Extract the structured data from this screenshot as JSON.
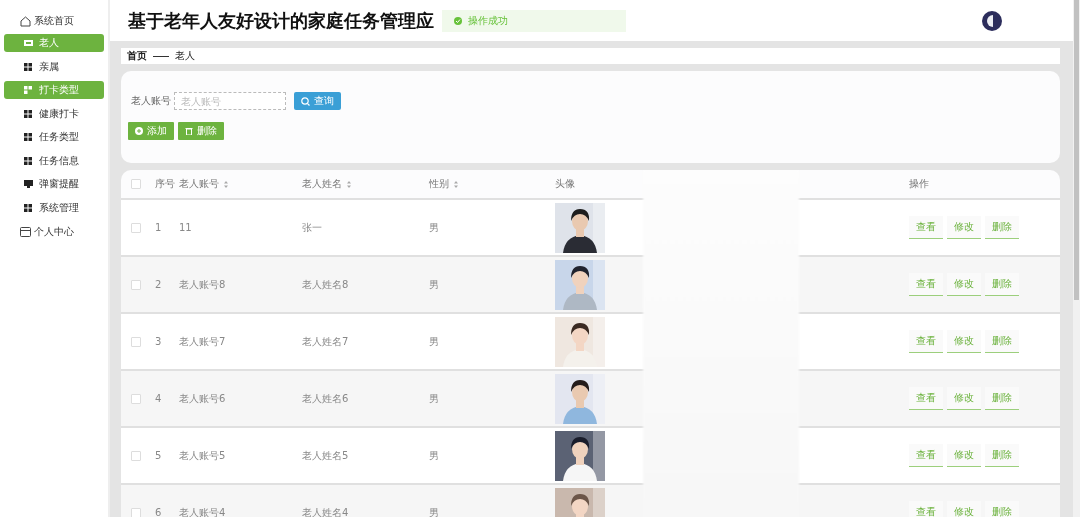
{
  "sidebar": {
    "home": "系统首页",
    "items": [
      {
        "label": "老人",
        "kind": "card",
        "selected": true
      },
      {
        "label": "亲属",
        "kind": "grid",
        "selected": false
      },
      {
        "label": "打卡类型",
        "kind": "grid",
        "selected": true
      },
      {
        "label": "健康打卡",
        "kind": "grid",
        "selected": false
      },
      {
        "label": "任务类型",
        "kind": "grid",
        "selected": false
      },
      {
        "label": "任务信息",
        "kind": "grid",
        "selected": false
      },
      {
        "label": "弹窗提醒",
        "kind": "monitor",
        "selected": false
      },
      {
        "label": "系统管理",
        "kind": "grid",
        "selected": false
      }
    ],
    "profile": "个人中心"
  },
  "header": {
    "title": "基于老年人友好设计的家庭任务管理应",
    "toast": "操作成功"
  },
  "breadcrumb": [
    "首页",
    "老人"
  ],
  "search": {
    "label": "老人账号",
    "placeholder": "老人账号",
    "button": "查询"
  },
  "actions": [
    "添加",
    "删除"
  ],
  "table": {
    "select_all_checked": false,
    "columns": [
      {
        "label": "序号",
        "sortable": false
      },
      {
        "label": "老人账号",
        "sortable": true
      },
      {
        "label": "老人姓名",
        "sortable": true
      },
      {
        "label": "性别",
        "sortable": true
      },
      {
        "label": "头像",
        "sortable": false
      },
      {
        "label": "操作",
        "sortable": false
      }
    ],
    "rows": [
      {
        "index": "1",
        "account": "11",
        "name": "张一",
        "gender": "男",
        "checked": false,
        "ops": [
          "查看",
          "修改",
          "删除"
        ]
      },
      {
        "index": "2",
        "account": "老人账号8",
        "name": "老人姓名8",
        "gender": "男",
        "checked": false,
        "ops": [
          "查看",
          "修改",
          "删除"
        ]
      },
      {
        "index": "3",
        "account": "老人账号7",
        "name": "老人姓名7",
        "gender": "男",
        "checked": false,
        "ops": [
          "查看",
          "修改",
          "删除"
        ]
      },
      {
        "index": "4",
        "account": "老人账号6",
        "name": "老人姓名6",
        "gender": "男",
        "checked": false,
        "ops": [
          "查看",
          "修改",
          "删除"
        ]
      },
      {
        "index": "5",
        "account": "老人账号5",
        "name": "老人姓名5",
        "gender": "男",
        "checked": false,
        "ops": [
          "查看",
          "修改",
          "删除"
        ]
      },
      {
        "index": "6",
        "account": "老人账号4",
        "name": "老人姓名4",
        "gender": "男",
        "checked": false,
        "ops": [
          "查看",
          "修改",
          "删除"
        ]
      }
    ]
  }
}
